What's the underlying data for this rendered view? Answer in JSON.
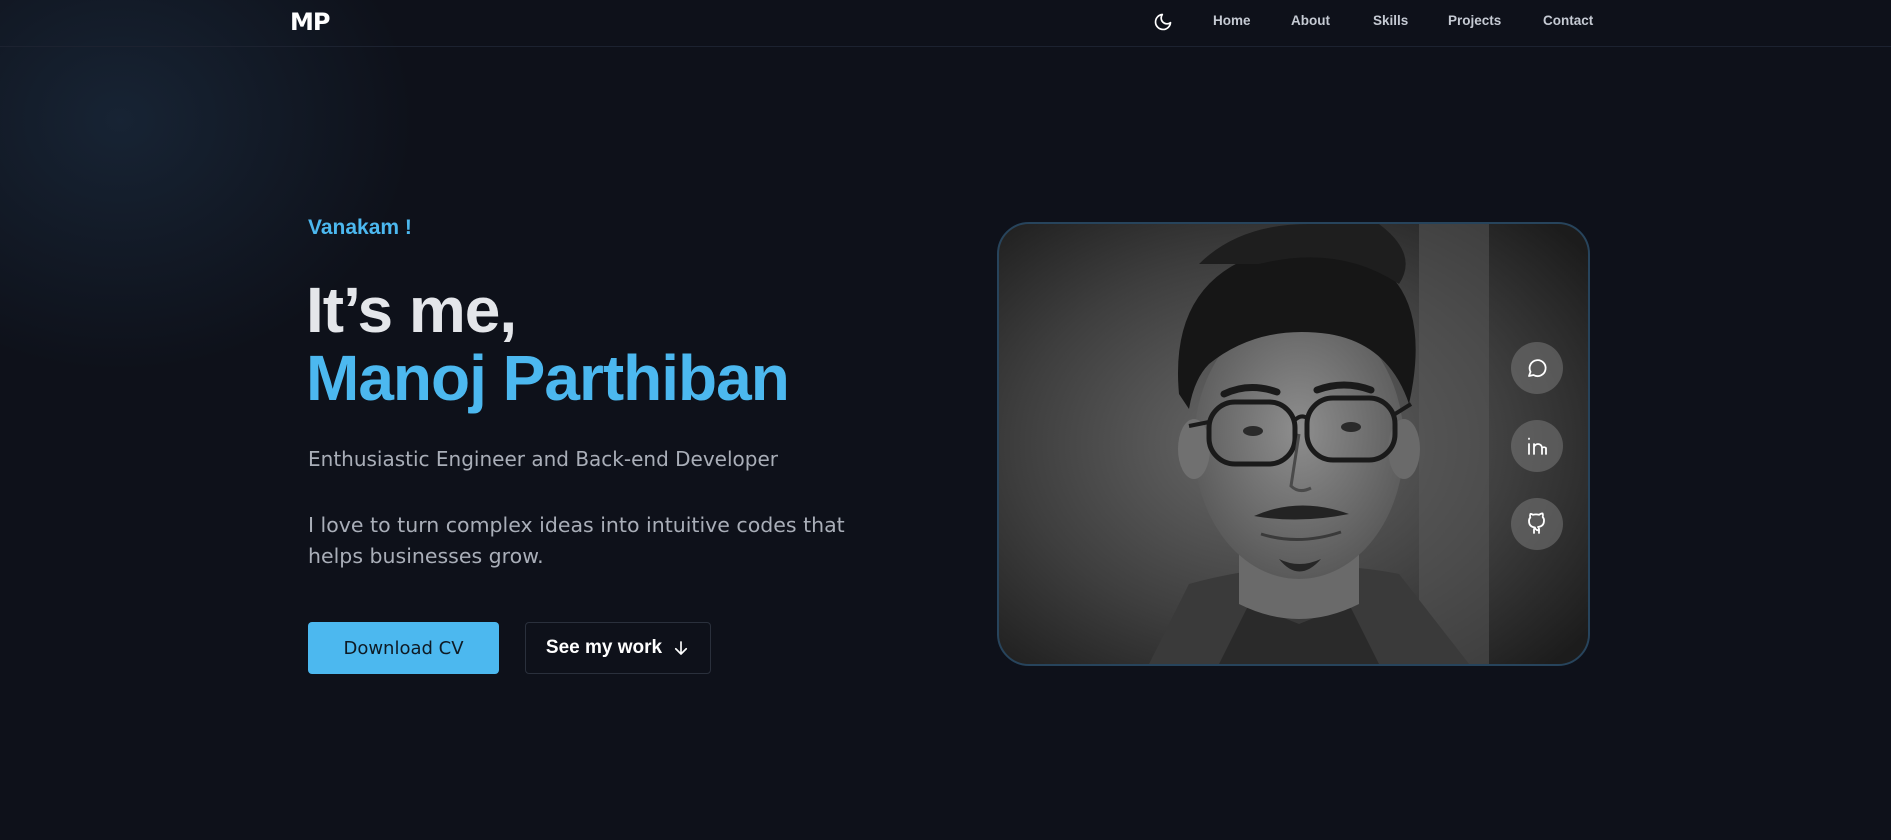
{
  "nav": {
    "logo": "MP",
    "theme_icon": "moon-icon",
    "links": [
      "Home",
      "About",
      "Skills",
      "Projects",
      "Contact"
    ]
  },
  "hero": {
    "greeting": "Vanakam !",
    "intro": "It’s me,",
    "name": "Manoj Parthiban",
    "role": "Enthusiastic Engineer and Back-end Developer",
    "description": "I love to turn complex ideas into intuitive codes that helps businesses grow.",
    "primary_button": "Download CV",
    "secondary_button": "See my work",
    "secondary_button_icon": "arrow-down-icon"
  },
  "photo": {
    "social_icons": [
      "chat-icon",
      "linkedin-icon",
      "github-icon"
    ]
  },
  "colors": {
    "background": "#0e111a",
    "accent": "#4cb8ef",
    "text": "#e4e6ea",
    "muted": "#a9aeb8"
  }
}
